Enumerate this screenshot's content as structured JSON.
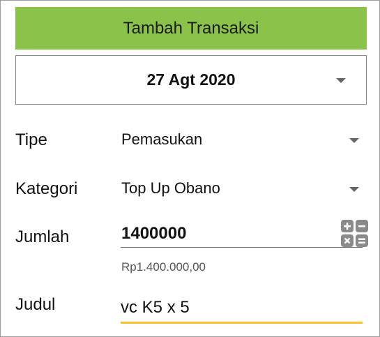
{
  "header": {
    "title": "Tambah Transaksi",
    "color": "#8bc34a"
  },
  "date": {
    "value": "27 Agt 2020",
    "icon": "chevron-down-icon"
  },
  "form": {
    "tipe": {
      "label": "Tipe",
      "value": "Pemasukan"
    },
    "kategori": {
      "label": "Kategori",
      "value": "Top Up Obano"
    },
    "jumlah": {
      "label": "Jumlah",
      "value": "1400000",
      "formatted": "Rp1.400.000,00",
      "icon": "calculator-icon"
    },
    "judul": {
      "label": "Judul",
      "value": "vc K5 x 5",
      "underline_color": "#fbc02d"
    }
  }
}
